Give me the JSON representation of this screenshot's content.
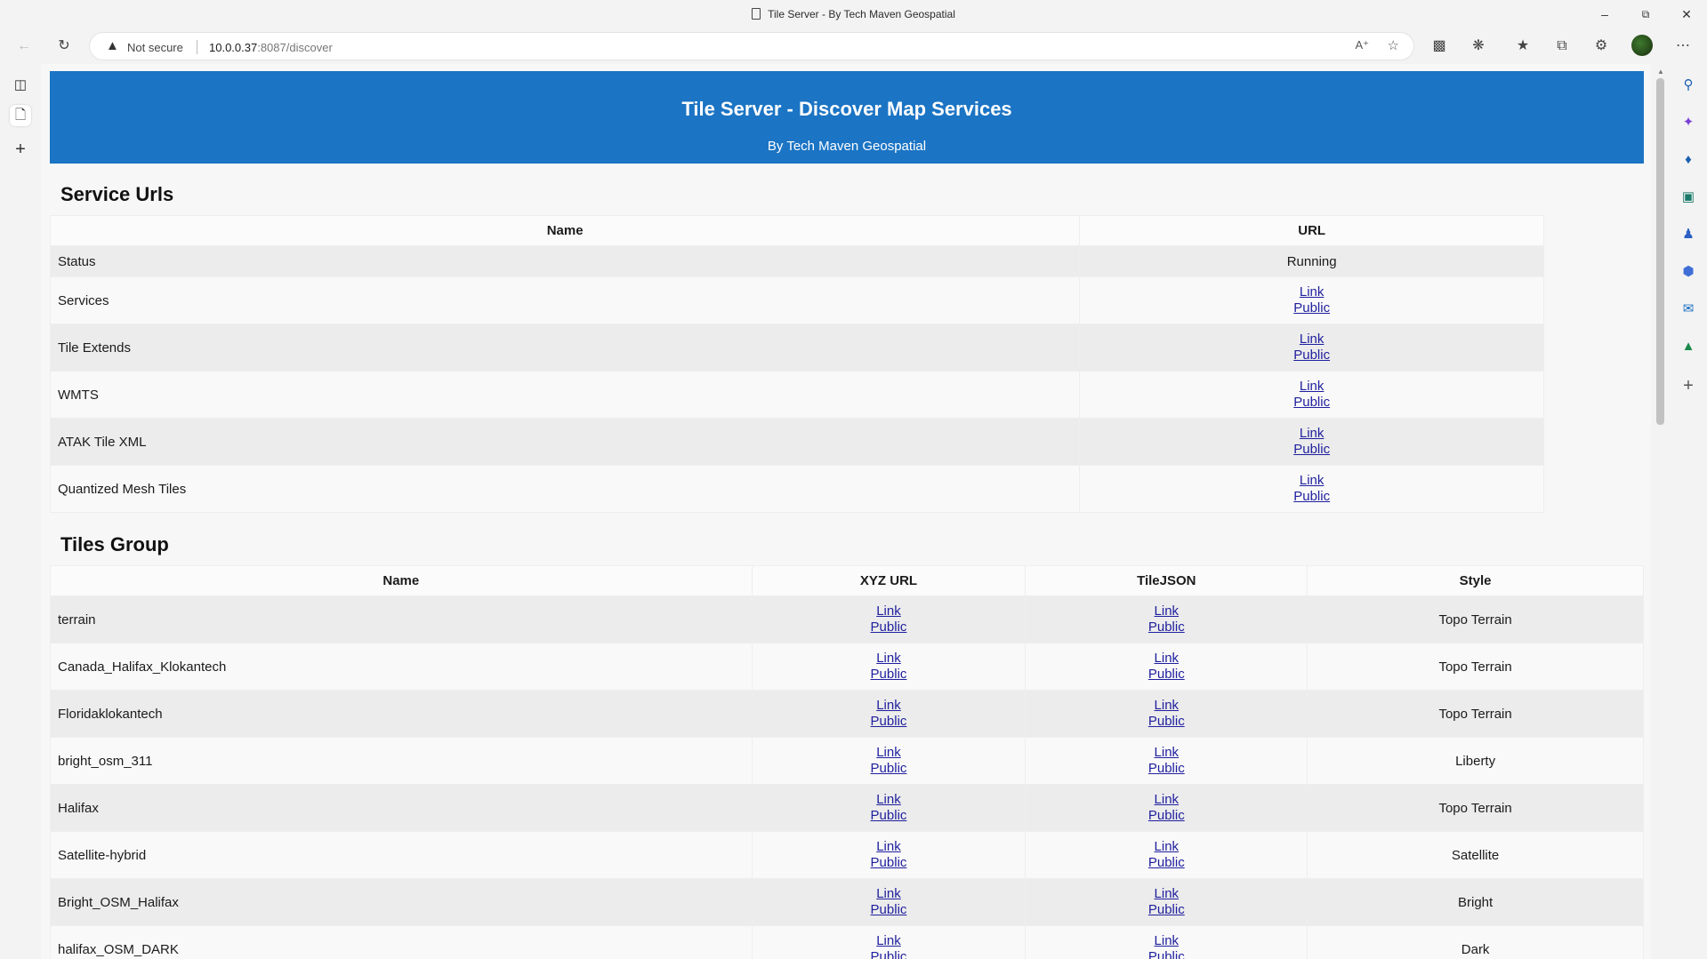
{
  "window": {
    "title": "Tile Server - By Tech Maven Geospatial"
  },
  "addressbar": {
    "security": "Not secure",
    "host": "10.0.0.37",
    "path": ":8087/discover"
  },
  "page": {
    "banner_title": "Tile Server - Discover Map Services",
    "banner_subtitle": "By Tech Maven Geospatial",
    "service_section_title": "Service Urls",
    "service_headers": {
      "name": "Name",
      "url": "URL"
    },
    "status_row": {
      "name": "Status",
      "value": "Running"
    },
    "services": [
      {
        "name": "Services",
        "link": "Link",
        "public": "Public"
      },
      {
        "name": "Tile Extends",
        "link": "Link",
        "public": "Public"
      },
      {
        "name": "WMTS",
        "link": "Link",
        "public": "Public"
      },
      {
        "name": "ATAK Tile XML",
        "link": "Link",
        "public": "Public"
      },
      {
        "name": "Quantized Mesh Tiles",
        "link": "Link",
        "public": "Public"
      }
    ],
    "tiles_section_title": "Tiles Group",
    "tiles_headers": {
      "name": "Name",
      "xyz": "XYZ URL",
      "tilejson": "TileJSON",
      "style": "Style"
    },
    "tiles": [
      {
        "name": "terrain",
        "link": "Link",
        "public": "Public",
        "style": "Topo Terrain"
      },
      {
        "name": "Canada_Halifax_Klokantech",
        "link": "Link",
        "public": "Public",
        "style": "Topo Terrain"
      },
      {
        "name": "Floridaklokantech",
        "link": "Link",
        "public": "Public",
        "style": "Topo Terrain"
      },
      {
        "name": "bright_osm_311",
        "link": "Link",
        "public": "Public",
        "style": "Liberty"
      },
      {
        "name": "Halifax",
        "link": "Link",
        "public": "Public",
        "style": "Topo Terrain"
      },
      {
        "name": "Satellite-hybrid",
        "link": "Link",
        "public": "Public",
        "style": "Satellite"
      },
      {
        "name": "Bright_OSM_Halifax",
        "link": "Link",
        "public": "Public",
        "style": "Bright"
      },
      {
        "name": "halifax_OSM_DARK",
        "link": "Link",
        "public": "Public",
        "style": "Dark"
      }
    ]
  },
  "icons": {
    "banner_color": "#1b74c4",
    "link_color": "#1f1f9e"
  }
}
